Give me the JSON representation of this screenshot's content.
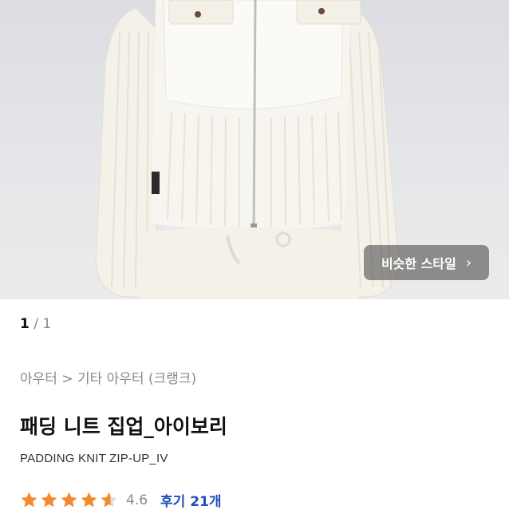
{
  "product_image": {
    "alt": "",
    "similar_style_label": "비슷한 스타일",
    "accent": "#f0a24a"
  },
  "pager": {
    "current": "1",
    "separator": "/",
    "total": "1"
  },
  "breadcrumb": "아우터 > 기타 아우터 (크랭크)",
  "product": {
    "title": "패딩 니트 집업_아이보리",
    "subtitle": "PADDING KNIT ZIP-UP_IV"
  },
  "rating": {
    "score": "4.6",
    "stars": 4.6,
    "star_color": "#f08c2e",
    "reviews_label": "후기 21개"
  }
}
